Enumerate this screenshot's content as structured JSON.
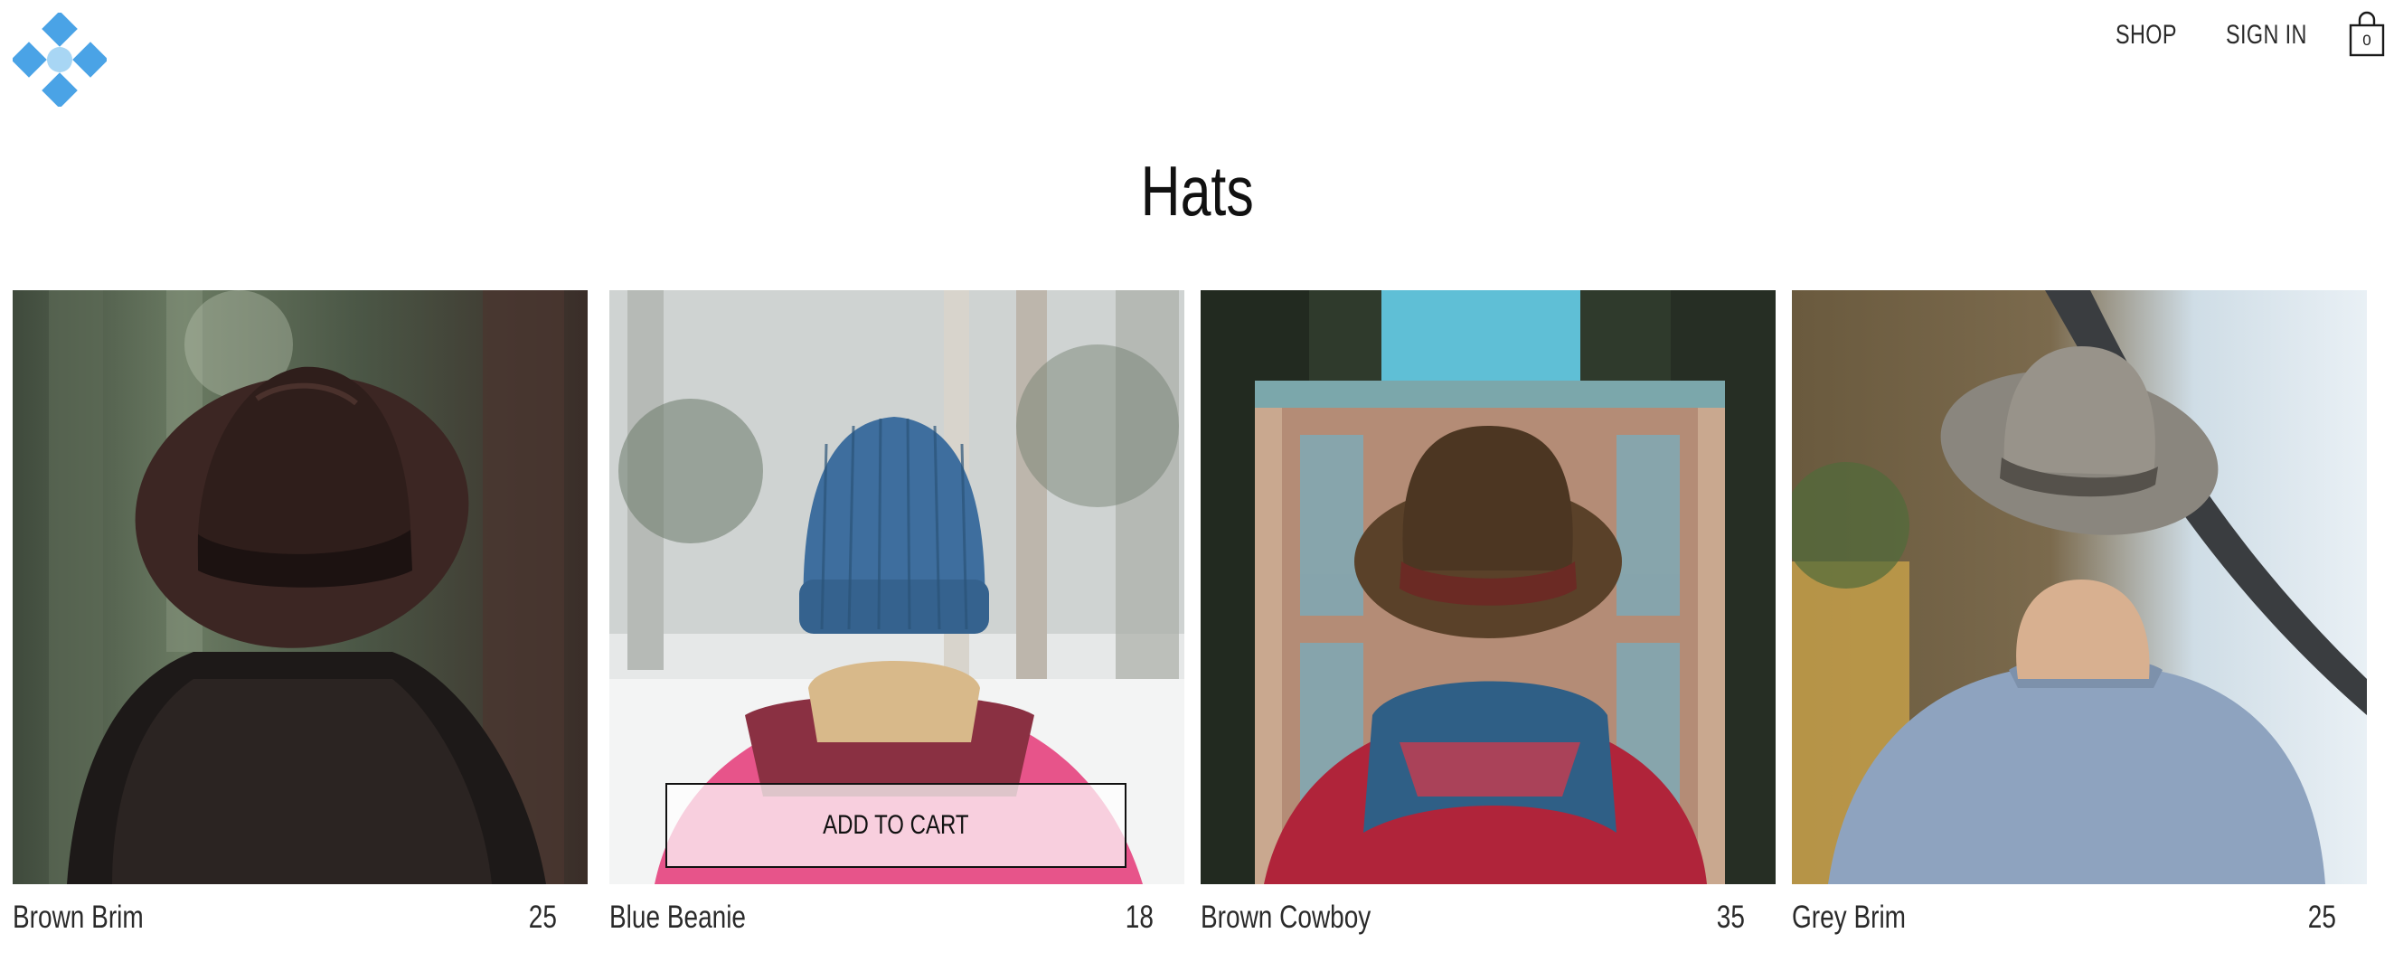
{
  "header": {
    "logo_icon": "crown-diamond-logo",
    "nav": {
      "shop_label": "SHOP",
      "signin_label": "SIGN IN"
    },
    "cart": {
      "icon": "shopping-bag-icon",
      "count": "0"
    }
  },
  "page": {
    "title": "Hats"
  },
  "products": [
    {
      "name": "Brown Brim",
      "price": "25"
    },
    {
      "name": "Blue Beanie",
      "price": "18",
      "add_to_cart_label": "ADD TO CART"
    },
    {
      "name": "Brown Cowboy",
      "price": "35"
    },
    {
      "name": "Grey Brim",
      "price": "25"
    }
  ],
  "colors": {
    "logo_blue": "#4aa3e6",
    "logo_light": "#a8d6f4",
    "text": "#1a1a1a",
    "background": "#ffffff"
  }
}
